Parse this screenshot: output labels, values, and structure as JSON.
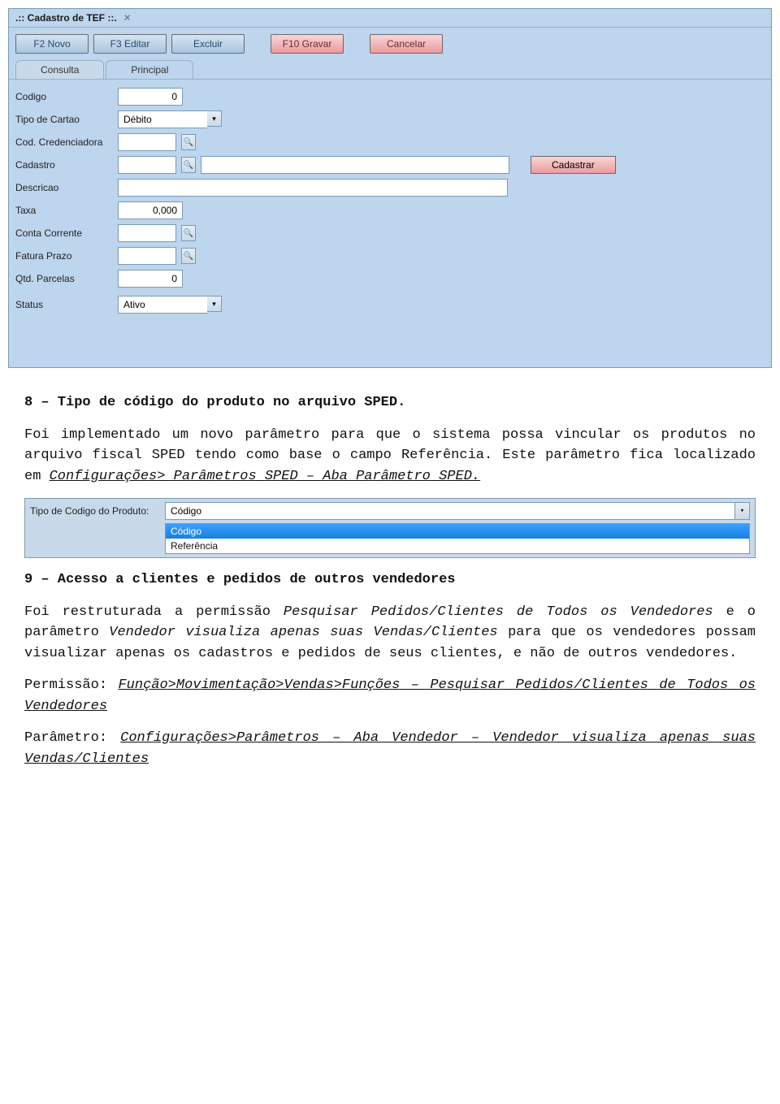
{
  "window": {
    "title": ".:: Cadastro de TEF ::.",
    "toolbar": {
      "novo": "F2 Novo",
      "editar": "F3 Editar",
      "excluir": "Excluir",
      "gravar": "F10 Gravar",
      "cancelar": "Cancelar"
    },
    "tabs": {
      "consulta": "Consulta",
      "principal": "Principal"
    },
    "fields": {
      "codigo_label": "Codigo",
      "codigo_value": "0",
      "tipo_cartao_label": "Tipo de Cartao",
      "tipo_cartao_value": "Débito",
      "cod_cred_label": "Cod. Credenciadora",
      "cod_cred_value": "",
      "cadastro_label": "Cadastro",
      "cadastro_value": "",
      "cadastro_lookup_value": "",
      "btn_cadastrar": "Cadastrar",
      "descricao_label": "Descricao",
      "descricao_value": "",
      "taxa_label": "Taxa",
      "taxa_value": "0,000",
      "conta_label": "Conta Corrente",
      "conta_value": "",
      "fatura_label": "Fatura Prazo",
      "fatura_value": "",
      "qtd_label": "Qtd. Parcelas",
      "qtd_value": "0",
      "status_label": "Status",
      "status_value": "Ativo"
    }
  },
  "doc": {
    "h8": "8 – Tipo de código do produto no arquivo SPED.",
    "p8a": "Foi implementado um novo parâmetro para que o sistema possa vincular os produtos no arquivo fiscal SPED tendo como base o campo Referência. Este parâmetro fica localizado em ",
    "p8b": "Configurações> Parâmetros SPED – Aba Parâmetro SPED.",
    "dd": {
      "label": "Tipo de Codigo do Produto:",
      "value": "Código",
      "opt1": "Código",
      "opt2": "Referência"
    },
    "h9": "9 – Acesso a clientes e pedidos de outros vendedores",
    "p9a": "Foi restruturada a permissão ",
    "p9b": "Pesquisar Pedidos/Clientes de Todos os Vendedores",
    "p9c": " e o parâmetro ",
    "p9d": "Vendedor visualiza apenas suas Vendas/Clientes",
    "p9e": " para que os vendedores possam visualizar apenas os cadastros e pedidos de seus clientes, e não de outros vendedores.",
    "perm_label": "Permissão: ",
    "perm_path": "Função>Movimentação>Vendas>Funções – Pesquisar Pedidos/Clientes de Todos os Vendedores",
    "param_label": "Parâmetro: ",
    "param_path": "Configurações>Parâmetros – Aba Vendedor – Vendedor visualiza apenas suas Vendas/Clientes"
  }
}
